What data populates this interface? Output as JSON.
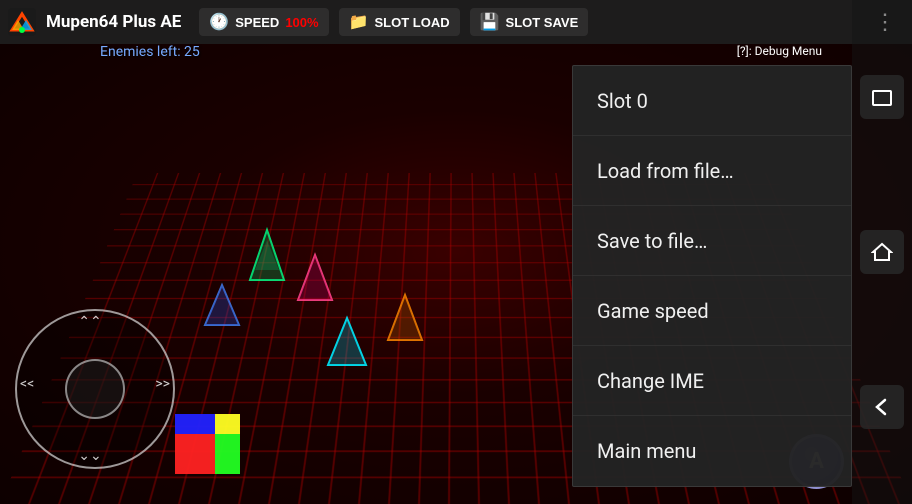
{
  "app": {
    "title": "Mupen64 Plus AE",
    "speed_label": "SPEED",
    "speed_value": "100%",
    "slot_load_label": "SLOT LOAD",
    "slot_save_label": "SLOT SAVE"
  },
  "hud": {
    "status_text": "Enemies left: 25",
    "corner_text": "[?]: Debug Menu"
  },
  "menu": {
    "items": [
      {
        "id": "slot0",
        "label": "Slot 0"
      },
      {
        "id": "load-file",
        "label": "Load from file…"
      },
      {
        "id": "save-file",
        "label": "Save to file…"
      },
      {
        "id": "game-speed",
        "label": "Game speed"
      },
      {
        "id": "change-ime",
        "label": "Change IME"
      },
      {
        "id": "main-menu",
        "label": "Main menu"
      }
    ]
  },
  "sidebar": {
    "buttons": [
      {
        "id": "window-btn",
        "icon": "⬜"
      },
      {
        "id": "home-btn",
        "icon": "⌂"
      },
      {
        "id": "back-btn",
        "icon": "↩"
      }
    ]
  },
  "controller": {
    "a_button_label": "A"
  }
}
